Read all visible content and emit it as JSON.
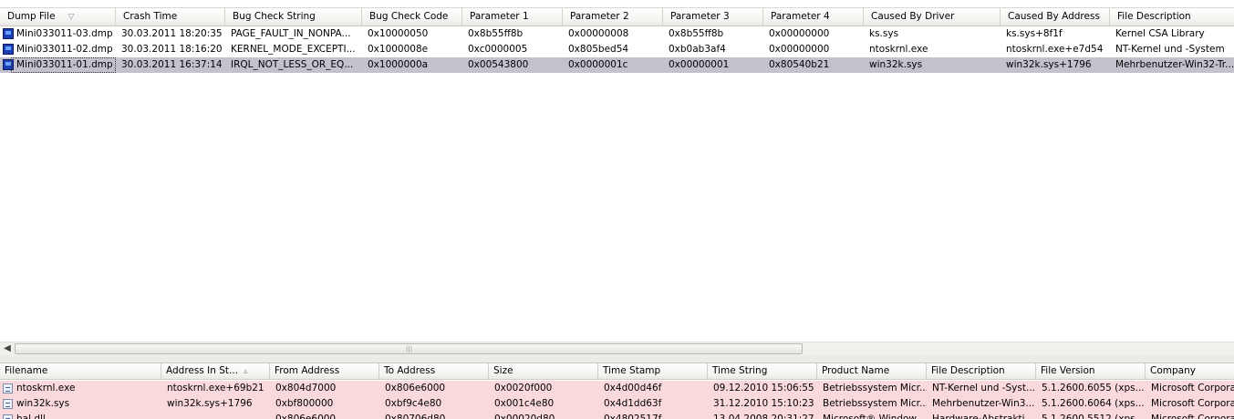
{
  "upper": {
    "columns": [
      "Dump File",
      "Crash Time",
      "Bug Check String",
      "Bug Check Code",
      "Parameter 1",
      "Parameter 2",
      "Parameter 3",
      "Parameter 4",
      "Caused By Driver",
      "Caused By Address",
      "File Description"
    ],
    "rows": [
      [
        "Mini033011-03.dmp",
        "30.03.2011 18:20:35",
        "PAGE_FAULT_IN_NONPA...",
        "0x10000050",
        "0x8b55ff8b",
        "0x00000008",
        "0x8b55ff8b",
        "0x00000000",
        "ks.sys",
        "ks.sys+8f1f",
        "Kernel CSA Library"
      ],
      [
        "Mini033011-02.dmp",
        "30.03.2011 18:16:20",
        "KERNEL_MODE_EXCEPTI...",
        "0x1000008e",
        "0xc0000005",
        "0x805bed54",
        "0xb0ab3af4",
        "0x00000000",
        "ntoskrnl.exe",
        "ntoskrnl.exe+e7d54",
        "NT-Kernel und -System"
      ],
      [
        "Mini033011-01.dmp",
        "30.03.2011 16:37:14",
        "IRQL_NOT_LESS_OR_EQ...",
        "0x1000000a",
        "0x00543800",
        "0x0000001c",
        "0x00000001",
        "0x80540b21",
        "win32k.sys",
        "win32k.sys+1796",
        "Mehrbenutzer-Win32-Tr..."
      ]
    ],
    "selected_index": 2,
    "sort_icon": "sort-arrow-icon"
  },
  "lower": {
    "columns": [
      "Filename",
      "Address In St...",
      "From Address",
      "To Address",
      "Size",
      "Time Stamp",
      "Time String",
      "Product Name",
      "File Description",
      "File Version",
      "Company"
    ],
    "rows": [
      [
        "ntoskrnl.exe",
        "ntoskrnl.exe+69b21",
        "0x804d7000",
        "0x806e6000",
        "0x0020f000",
        "0x4d00d46f",
        "09.12.2010 15:06:55",
        "Betriebssystem Micr...",
        "NT-Kernel und -Syst...",
        "5.1.2600.6055 (xps...",
        "Microsoft Corporat"
      ],
      [
        "win32k.sys",
        "win32k.sys+1796",
        "0xbf800000",
        "0xbf9c4e80",
        "0x001c4e80",
        "0x4d1dd63f",
        "31.12.2010 15:10:23",
        "Betriebssystem Micr...",
        "Mehrbenutzer-Win3...",
        "5.1.2600.6064 (xps...",
        "Microsoft Corporat"
      ],
      [
        "hal.dll",
        "",
        "0x806e6000",
        "0x80706d80",
        "0x00020d80",
        "0x4802517f",
        "13.04.2008 20:31:27",
        "Microsoft® Window...",
        "Hardware-Abstrakti...",
        "5.1.2600.5512 (xps...",
        "Microsoft Corporat"
      ]
    ],
    "highlight_color": "#fad9dc"
  },
  "scrollbar": {
    "left_arrow": "◀",
    "grip": "|||"
  },
  "colors": {
    "selection": "#c1c2cc",
    "header_bg": "#f3f3f1",
    "pink_row": "#fad9dc"
  }
}
